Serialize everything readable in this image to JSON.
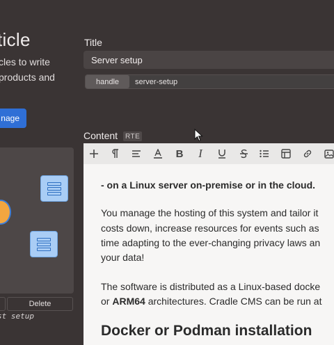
{
  "left": {
    "title": "ticle",
    "description_line1": "cles to write",
    "description_line2": "products and",
    "image_button": "nage",
    "delete_button": "Delete",
    "caption": "st setup"
  },
  "form": {
    "title_label": "Title",
    "title_value": "Server setup",
    "handle_tag": "handle",
    "handle_value": "server-setup",
    "content_label": "Content",
    "content_badge": "RTE"
  },
  "toolbar": {
    "items": [
      "add-icon",
      "paragraph-icon",
      "align-icon",
      "text-color-icon",
      "bold-icon",
      "italic-icon",
      "underline-icon",
      "strikethrough-icon",
      "bullet-list-icon",
      "table-icon",
      "link-icon",
      "image-icon"
    ]
  },
  "editor": {
    "bold_line": "- on a Linux server on-premise or in the cloud.",
    "p1_line1": "You manage the hosting of this system and tailor it",
    "p1_line2": "costs down, increase resources for events such as",
    "p1_line3": "time adapting to the ever-changing privacy laws an",
    "p1_line4": "your data!",
    "p2_line1": "The software is distributed as a Linux-based docke",
    "p2_line2_pre": "or ",
    "p2_line2_bold": "ARM64",
    "p2_line2_post": " architectures. Cradle CMS can be run at",
    "heading": "Docker or Podman installation"
  },
  "colors": {
    "background": "#3a3434",
    "accent_button": "#2f6fd6",
    "editor_bg": "#f7f6f5"
  }
}
